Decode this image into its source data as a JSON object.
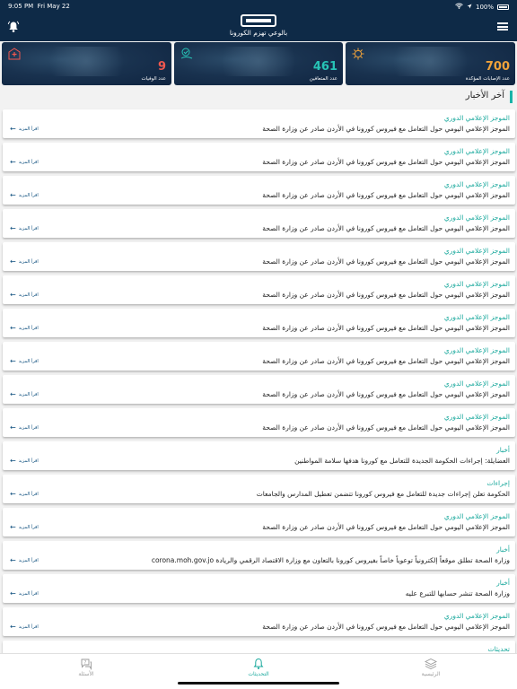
{
  "status_bar": {
    "time": "9:05 PM",
    "date": "Fri May 22",
    "battery": "100%"
  },
  "header": {
    "tagline": "بالوعي تهزم الكورونا"
  },
  "stats": [
    {
      "number": "9",
      "label": "عدد الوفيات",
      "color": "#f0574f",
      "icon": "hospital-icon"
    },
    {
      "number": "461",
      "label": "عدد المتعافين",
      "color": "#27c3b6",
      "icon": "recovered-icon"
    },
    {
      "number": "700",
      "label": "عدد الإصابات المؤكدة",
      "color": "#f0a23a",
      "icon": "virus-icon"
    }
  ],
  "news_section": {
    "title": "آخر الأخبار",
    "read_more": "اقرأ المزيد"
  },
  "news": [
    {
      "category": "الموجز الإعلامي الدوري",
      "description": "الموجز الإعلامي اليومي حول التعامل مع فيروس كورونا في الأردن صادر عن وزارة الصحة"
    },
    {
      "category": "الموجز الإعلامي الدوري",
      "description": "الموجز الإعلامي اليومي حول التعامل مع فيروس كورونا في الأردن صادر عن وزارة الصحة"
    },
    {
      "category": "الموجز الإعلامي الدوري",
      "description": "الموجز الإعلامي اليومي حول التعامل مع فيروس كورونا في الأردن صادر عن وزارة الصحة"
    },
    {
      "category": "الموجز الإعلامي الدوري",
      "description": "الموجز الإعلامي اليومي حول التعامل مع فيروس كورونا في الأردن صادر عن وزارة الصحة"
    },
    {
      "category": "الموجز الإعلامي الدوري",
      "description": "الموجز الإعلامي اليومي حول التعامل مع فيروس كورونا في الأردن صادر عن وزارة الصحة"
    },
    {
      "category": "الموجز الإعلامي الدوري",
      "description": "الموجز الإعلامي اليومي حول التعامل مع فيروس كورونا في الأردن صادر عن وزارة الصحة"
    },
    {
      "category": "الموجز الإعلامي الدوري",
      "description": "الموجز الإعلامي اليومي حول التعامل مع فيروس كورونا في الأردن صادر عن وزارة الصحة"
    },
    {
      "category": "الموجز الإعلامي الدوري",
      "description": "الموجز الإعلامي اليومي حول التعامل مع فيروس كورونا في الأردن صادر عن وزارة الصحة"
    },
    {
      "category": "الموجز الإعلامي الدوري",
      "description": "الموجز الإعلامي اليومي حول التعامل مع فيروس كورونا في الأردن صادر عن وزارة الصحة"
    },
    {
      "category": "الموجز الإعلامي الدوري",
      "description": "الموجز الإعلامي اليومي حول التعامل مع فيروس كورونا في الأردن صادر عن وزارة الصحة"
    },
    {
      "category": "أخبار",
      "description": "العضايلة: إجراءات الحكومة الجديدة للتعامل مع كورونا هدفها سلامة المواطنين"
    },
    {
      "category": "إجراءات",
      "description": "الحكومة تعلن إجراءات جديدة للتعامل مع فيروس كورونا تتضمن تعطيل المدارس والجامعات"
    },
    {
      "category": "الموجز الإعلامي الدوري",
      "description": "الموجز الإعلامي اليومي حول التعامل مع فيروس كورونا في الأردن صادر عن وزارة الصحة"
    },
    {
      "category": "أخبار",
      "description": "وزارة الصحة تطلق موقعاً إلكترونياً توعوياً خاصاً بفيروس كورونا بالتعاون مع وزارة الاقتصاد الرقمي والريادة corona.moh.gov.jo"
    },
    {
      "category": "أخبار",
      "description": "وزارة الصحة تنشر حسابها للتبرع عليه"
    },
    {
      "category": "الموجز الإعلامي الدوري",
      "description": "الموجز الإعلامي اليومي حول التعامل مع فيروس كورونا في الأردن صادر عن وزارة الصحة"
    },
    {
      "category": "تحديثات",
      "description": ""
    }
  ],
  "tabbar": {
    "questions": "الأسئلة",
    "updates": "التحديثات",
    "home": "الرئيسية"
  },
  "colors": {
    "header": "#0e2a47",
    "accent": "#18a89c"
  }
}
